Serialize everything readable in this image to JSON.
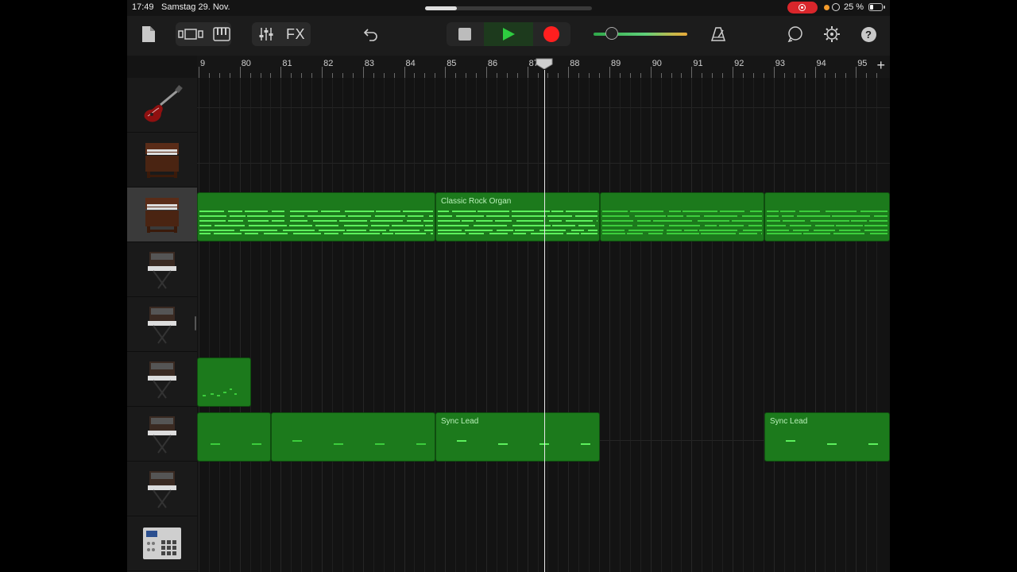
{
  "status": {
    "time": "17:49",
    "date": "Samstag 29. Nov.",
    "battery": "25 %"
  },
  "toolbar": {
    "fx_label": "FX",
    "icons": [
      "document-icon",
      "tracks-view-icon",
      "keyboard-icon",
      "mixer-icon",
      "undo-icon",
      "stop-icon",
      "play-icon",
      "record-icon",
      "metronome-icon",
      "loop-icon",
      "settings-icon",
      "help-icon"
    ],
    "help_label": "?"
  },
  "colors": {
    "region": "#1c7a1c",
    "note": "#5cf05c",
    "record": "#ff1f1f",
    "play": "#2ecc40"
  },
  "transport": {
    "master_volume": 0.2
  },
  "ruler": {
    "bars": [
      "9",
      "80",
      "81",
      "82",
      "83",
      "84",
      "85",
      "86",
      "87",
      "88",
      "89",
      "90",
      "91",
      "92",
      "93",
      "94",
      "95"
    ],
    "add_label": "+"
  },
  "tracks": [
    {
      "instrument": "electric-guitar-icon"
    },
    {
      "instrument": "organ-icon"
    },
    {
      "instrument": "organ-icon",
      "selected": true
    },
    {
      "instrument": "synth-icon"
    },
    {
      "instrument": "synth-icon"
    },
    {
      "instrument": "synth-icon"
    },
    {
      "instrument": "synth-icon"
    },
    {
      "instrument": "synth-icon"
    },
    {
      "instrument": "drum-machine-icon"
    }
  ],
  "regions": {
    "organ_label": "Classic Rock Organ",
    "sync_lead_label": "Sync Lead",
    "sync_lead_label_2": "Sync Lead"
  }
}
